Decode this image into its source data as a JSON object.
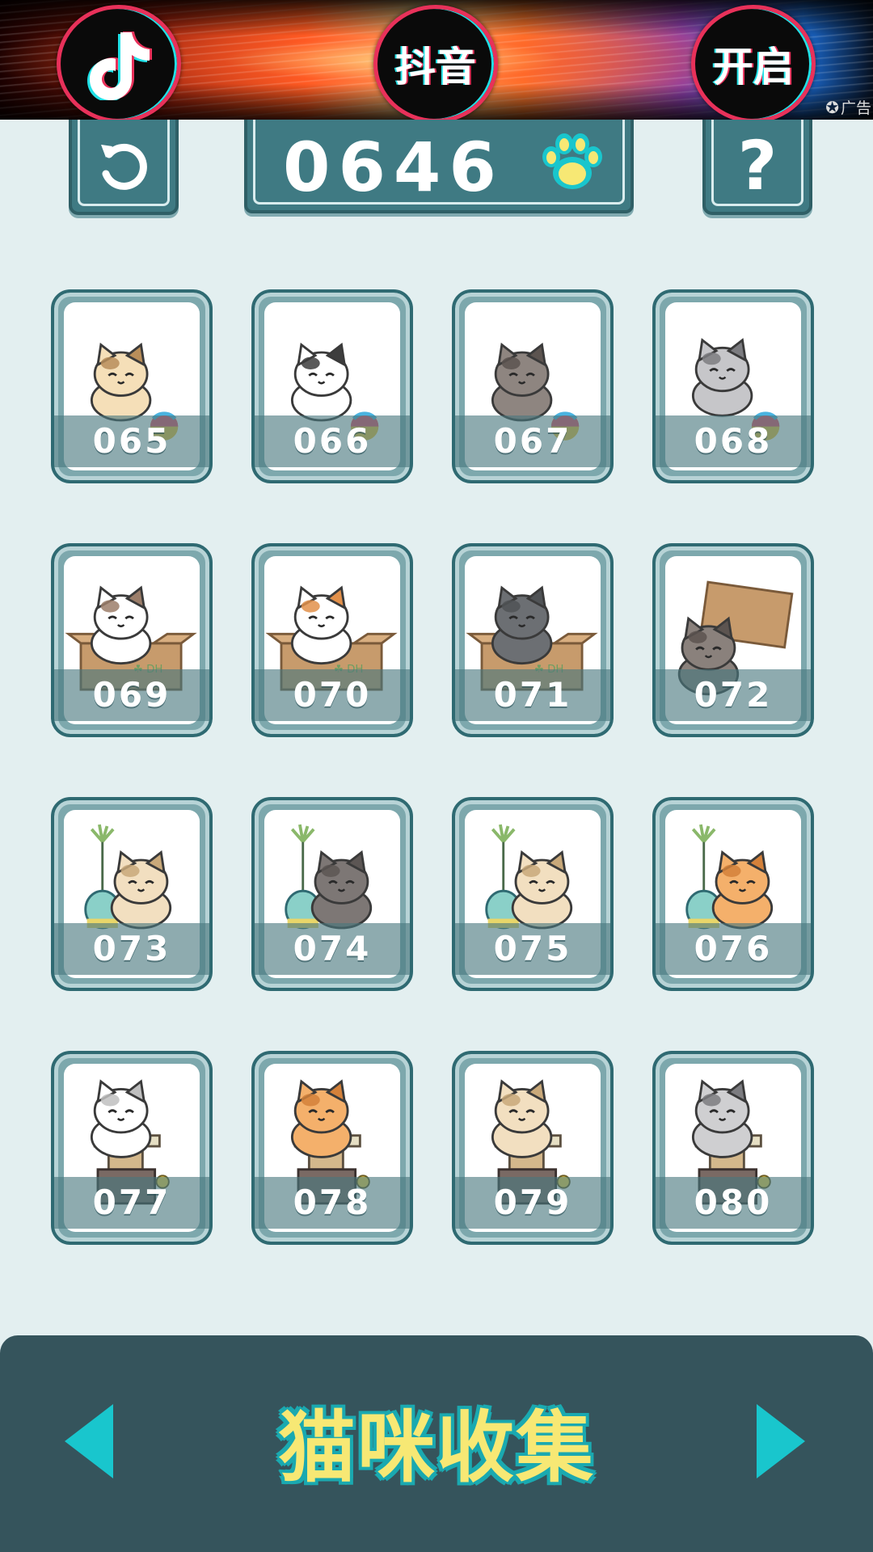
{
  "ad": {
    "items": [
      "♪",
      "抖音",
      "开启"
    ],
    "label": "广告"
  },
  "header": {
    "score": "0646",
    "help_label": "?"
  },
  "cards": [
    {
      "number": "065",
      "art": "calico-cat-ball"
    },
    {
      "number": "066",
      "art": "tuxedo-cat-ball"
    },
    {
      "number": "067",
      "art": "tabby-cat-ball"
    },
    {
      "number": "068",
      "art": "gray-cat-on-ball"
    },
    {
      "number": "069",
      "art": "calico-cat-box"
    },
    {
      "number": "070",
      "art": "tricolor-cat-box"
    },
    {
      "number": "071",
      "art": "gray-cat-box"
    },
    {
      "number": "072",
      "art": "tabby-cat-under-box"
    },
    {
      "number": "073",
      "art": "cream-cat-toy"
    },
    {
      "number": "074",
      "art": "gray-cat-toy"
    },
    {
      "number": "075",
      "art": "cream-cat-toy"
    },
    {
      "number": "076",
      "art": "orange-cat-toy"
    },
    {
      "number": "077",
      "art": "white-cat-tower"
    },
    {
      "number": "078",
      "art": "orange-cat-tower"
    },
    {
      "number": "079",
      "art": "cream-cat-tower"
    },
    {
      "number": "080",
      "art": "gray-cat-tower"
    }
  ],
  "footer": {
    "title": "猫咪收集"
  },
  "colors": {
    "background": "#e3eff0",
    "panel": "#3f7a83",
    "footer": "#35545c",
    "accent_cyan": "#19c6cd",
    "title_yellow": "#f7e874"
  }
}
